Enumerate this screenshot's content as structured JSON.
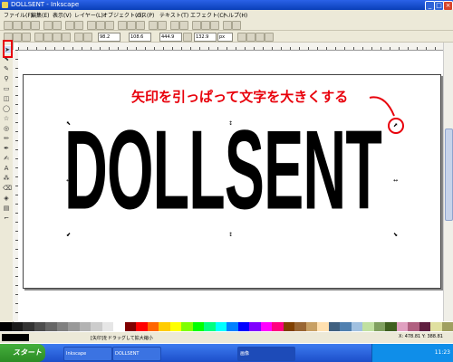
{
  "window": {
    "title": "DOLLSENT - Inkscape"
  },
  "menu": [
    "ファイル(F)",
    "編集(E)",
    "表示(V)",
    "レイヤー(L)",
    "オブジェクト(O)",
    "パス(P)",
    "テキスト(T)",
    "エフェクト(C)",
    "ヘルプ(H)"
  ],
  "toolbar2": {
    "x_value": "98.2",
    "y_value": "108.6",
    "w_value": "444.9",
    "h_value": "132.9",
    "unit": "px"
  },
  "canvas": {
    "logo_text": "DOLLSENT",
    "annotation": "矢印を引っぱって文字を大きくする"
  },
  "colors": {
    "annotation": "#e8000b",
    "tool_highlight": "#e8000b"
  },
  "statusbar": {
    "message": "[矢印]をドラッグして拡大縮小",
    "coords": "X: 478.81  Y: 388.81"
  },
  "taskbar": {
    "start_label": "スタート",
    "items": [
      "Inkscape",
      "DOLLSENT",
      "画像"
    ],
    "clock": "11:23"
  }
}
